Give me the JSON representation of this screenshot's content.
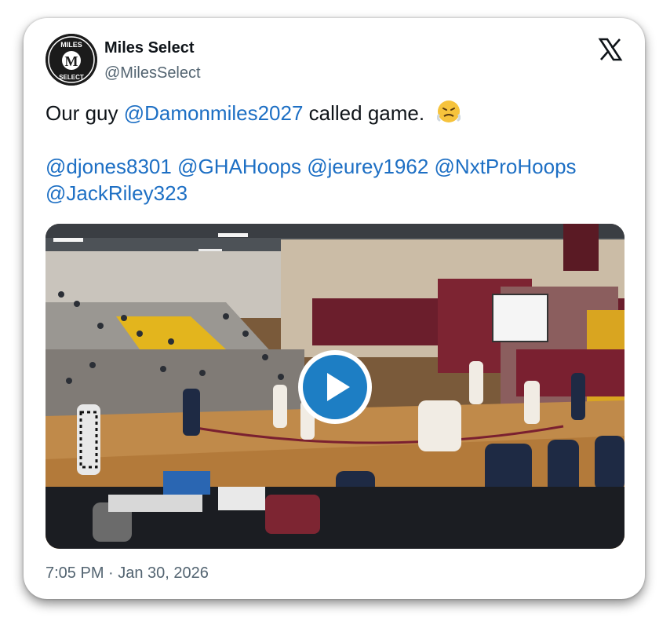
{
  "author": {
    "display_name": "Miles Select",
    "handle": "@MilesSelect",
    "avatar_text_top": "MILES",
    "avatar_letter": "M",
    "avatar_text_bottom": "SELECT"
  },
  "tweet": {
    "line1_prefix": "Our guy ",
    "line1_mention": "@Damonmiles2027",
    "line1_suffix": " called game.",
    "emoji": "steam-face-emoji",
    "mentions_line2": [
      "@djones8301",
      "@GHAHoops",
      "@jeurey1962",
      "@NxtProHoops"
    ],
    "mentions_line3": [
      "@JackRiley323"
    ]
  },
  "media": {
    "type": "video",
    "play_icon": "play-icon",
    "accent": "#1d7ec4"
  },
  "timestamp": "7:05 PM · Jan 30, 2026",
  "colors": {
    "link": "#1d6fc4",
    "text": "#0f1419",
    "secondary": "#536471"
  }
}
